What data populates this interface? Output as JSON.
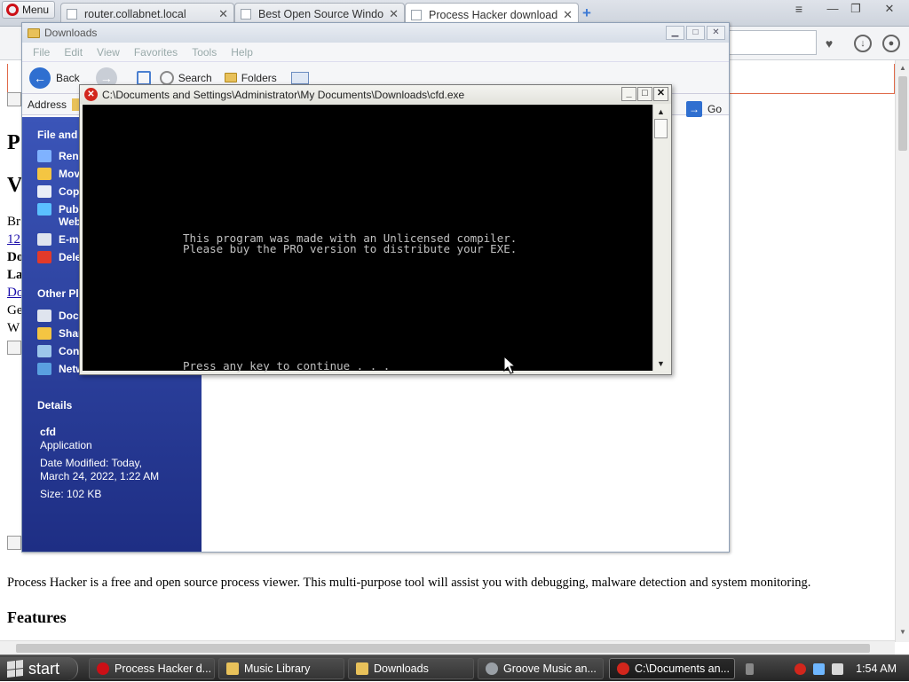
{
  "browser": {
    "menu_label": "Menu",
    "tabs": [
      {
        "title": "router.collabnet.local"
      },
      {
        "title": "Best Open Source Window"
      },
      {
        "title": "Process Hacker download"
      }
    ],
    "close_glyph": "✕",
    "new_tab_glyph": "+",
    "window_controls": {
      "minimize": "—",
      "restore": "❐",
      "close": "✕"
    }
  },
  "webpage": {
    "fragments": [
      {
        "text": "P"
      },
      {
        "text": "V"
      },
      {
        "text": "Br"
      },
      {
        "text": "12"
      },
      {
        "text": "Do"
      },
      {
        "text": "La"
      },
      {
        "text": "Do"
      },
      {
        "text": "Ge"
      },
      {
        "text": "W"
      }
    ],
    "description": "Process Hacker is a free and open source process viewer. This multi-purpose tool will assist you with debugging, malware detection and system monitoring.",
    "features_heading": "Features"
  },
  "explorer": {
    "title": "Downloads",
    "menu": [
      "File",
      "Edit",
      "View",
      "Favorites",
      "Tools",
      "Help"
    ],
    "toolbar": {
      "back": "Back",
      "search": "Search",
      "folders": "Folders"
    },
    "address_label": "Address",
    "go_label": "Go",
    "file_tasks": {
      "header": "File and",
      "items": [
        "Ren",
        "Mov",
        "Cop",
        "Pub",
        "E-m",
        "Dele"
      ],
      "web_suffix": "Web"
    },
    "other_places": {
      "header": "Other Pl",
      "items": [
        "Doc",
        "Shar",
        "Con",
        "Netw"
      ]
    },
    "details": {
      "header": "Details",
      "name": "cfd",
      "type": "Application",
      "modified_line1": "Date Modified: Today,",
      "modified_line2": "March 24, 2022, 1:22 AM",
      "size": "Size: 102 KB"
    }
  },
  "console": {
    "title": "C:\\Documents and Settings\\Administrator\\My Documents\\Downloads\\cfd.exe",
    "line1": "This program was made with an Unlicensed compiler.",
    "line2": "Please buy the PRO version to distribute your EXE.",
    "line3": "Press any key to continue . . ."
  },
  "taskbar": {
    "start_label": "start",
    "tasks": [
      {
        "label": "Process Hacker d..."
      },
      {
        "label": "Music Library"
      },
      {
        "label": "Downloads"
      },
      {
        "label": "Groove Music an..."
      },
      {
        "label": "C:\\Documents an..."
      }
    ],
    "clock": "1:54 AM"
  },
  "colors": {
    "opera_red": "#cc0f16",
    "xp_taskpane": "#2a3c98",
    "console_bg": "#000000",
    "error_red": "#d2261c"
  }
}
